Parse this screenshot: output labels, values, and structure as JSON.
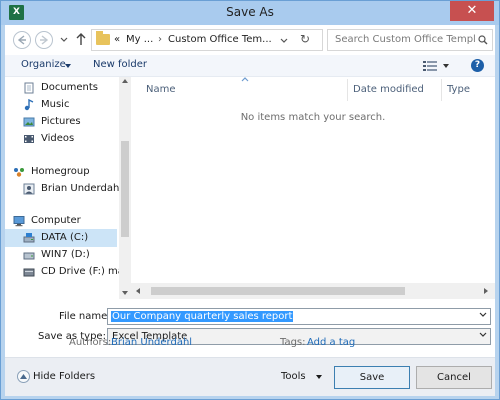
{
  "window": {
    "title": "Save As",
    "app_icon_letter": "X",
    "close_glyph": "✕"
  },
  "address": {
    "overflow_glyph": "«",
    "crumbs": [
      "My ...",
      "Custom Office Tem..."
    ],
    "separator": "›",
    "refresh_glyph": "↻"
  },
  "search": {
    "placeholder": "Search Custom Office Templa..."
  },
  "toolbar": {
    "organize_label": "Organize",
    "new_folder_label": "New folder",
    "help_glyph": "?"
  },
  "nav": {
    "items": [
      {
        "label": "Documents",
        "icon": "documents-icon"
      },
      {
        "label": "Music",
        "icon": "music-icon"
      },
      {
        "label": "Pictures",
        "icon": "pictures-icon"
      },
      {
        "label": "Videos",
        "icon": "videos-icon"
      },
      {
        "label": "Homegroup",
        "icon": "homegroup-icon"
      },
      {
        "label": "Brian Underdahl",
        "icon": "user-icon"
      },
      {
        "label": "Computer",
        "icon": "computer-icon"
      },
      {
        "label": "DATA (C:)",
        "icon": "drive-icon",
        "selected": true
      },
      {
        "label": "WIN7 (D:)",
        "icon": "drive-icon"
      },
      {
        "label": "CD Drive (F:) mag",
        "icon": "cd-drive-icon"
      }
    ]
  },
  "file_list": {
    "columns": [
      "Name",
      "Date modified",
      "Type"
    ],
    "empty_message": "No items match your search."
  },
  "form": {
    "file_name_label": "File name:",
    "file_name_value": "Our Company quarterly sales report",
    "save_type_label": "Save as type:",
    "save_type_value": "Excel Template",
    "authors_label": "Authors:",
    "authors_value": "Brian Underdahl",
    "tags_label": "Tags:",
    "tags_value": "Add a tag"
  },
  "footer": {
    "hide_folders_label": "Hide Folders",
    "tools_label": "Tools",
    "save_label": "Save",
    "cancel_label": "Cancel"
  },
  "colors": {
    "accent": "#3399ff",
    "link": "#1f6bb8",
    "title_bar": "#a9cbee",
    "close": "#c75050"
  }
}
